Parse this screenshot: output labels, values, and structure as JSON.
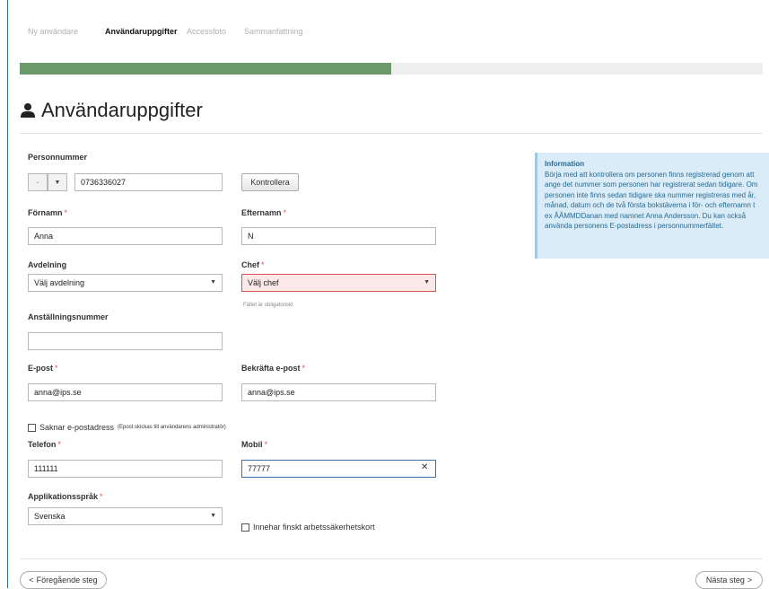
{
  "steps": [
    "Ny användare",
    "Användaruppgifter",
    "Accessfoto",
    "Sammanfattning"
  ],
  "progress": {
    "fraction": 0.5
  },
  "title": "Användaruppgifter",
  "form": {
    "personnummer": {
      "label": "Personnummer",
      "prefix_value": "-",
      "value": "0736336027",
      "check_button": "Kontrollera"
    },
    "fornamn": {
      "label": "Förnamn",
      "value": "Anna"
    },
    "efternamn": {
      "label": "Efternamn",
      "value": "N"
    },
    "avdelning": {
      "label": "Avdelning",
      "value": "Välj avdelning"
    },
    "chef": {
      "label": "Chef",
      "value": "Välj chef",
      "error": "Fältet är obligatoriskt"
    },
    "anstallningsnummer": {
      "label": "Anställningsnummer",
      "value": ""
    },
    "epost": {
      "label": "E-post",
      "value": "anna@ips.se"
    },
    "bekrafta_epost": {
      "label": "Bekräfta e-post",
      "value": "anna@ips.se"
    },
    "saknar_epost": {
      "label": "Saknar e-postadress",
      "note": "(Epost skickas till användarens administratör)"
    },
    "telefon": {
      "label": "Telefon",
      "value": "111111"
    },
    "mobil": {
      "label": "Mobil",
      "value": "77777"
    },
    "sprak": {
      "label": "Applikationsspråk",
      "value": "Svenska"
    },
    "finskt": {
      "label": "Innehar finskt arbetssäkerhetskort"
    },
    "required_mark": "*"
  },
  "info": {
    "title": "Information",
    "text": "Börja med att kontrollera om personen finns registrerad genom att ange det nummer som personen har registrerat sedan tidigare. Om personen inte finns sedan tidigare ska nummer registreras med år, månad, datum och de två första bokstäverna i för- och efternamn t ex ÅÅMMDDanan med namnet Anna Andersson. Du kan också använda personens E-postadress i personnummerfältet."
  },
  "nav": {
    "prev": "Föregående steg",
    "next": "Nästa steg",
    "prev_glyph": "<",
    "next_glyph": ">"
  },
  "icons": {
    "dropdown": "caret-down-icon",
    "clear": "close-icon",
    "user": "user-icon"
  },
  "colors": {
    "progress": "#6a9a6a",
    "error_border": "#d9534f",
    "info_bg": "#d9ecf7"
  }
}
